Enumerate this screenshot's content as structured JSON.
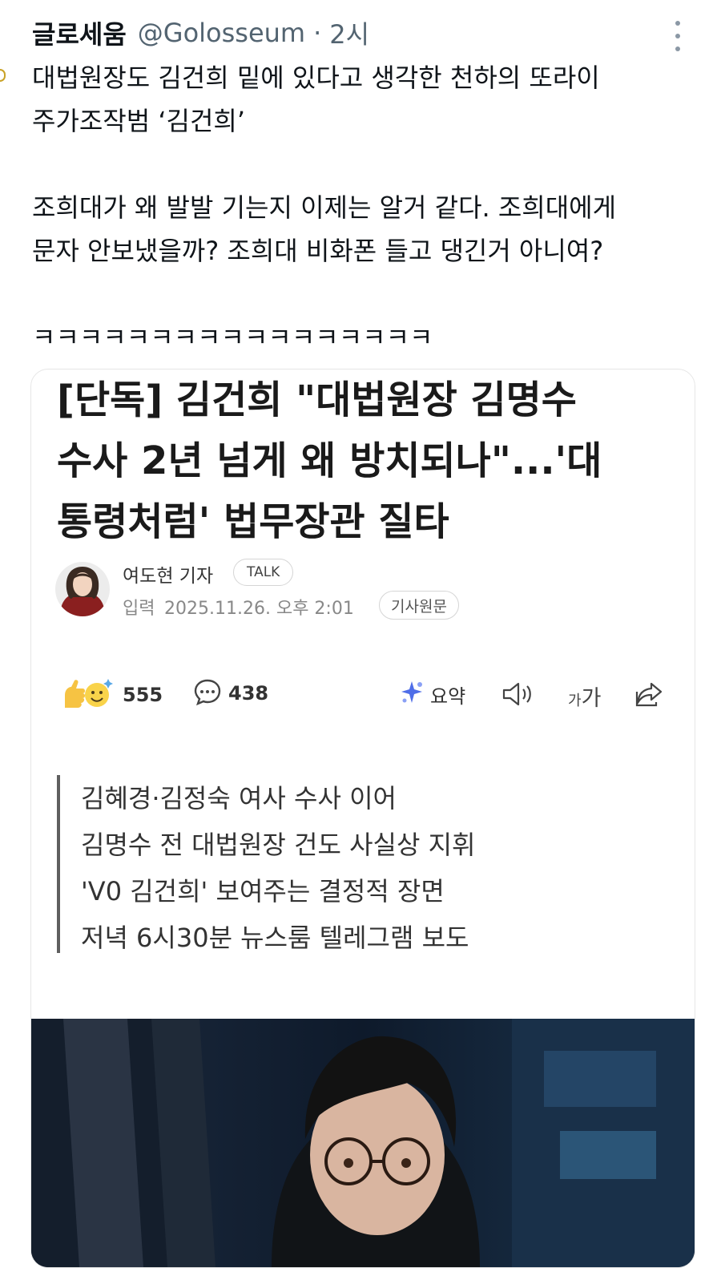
{
  "tweet": {
    "author_name": "글로세움",
    "author_handle": "@Golosseum",
    "separator": "·",
    "time": "2시",
    "lines": [
      "대법원장도 김건희 밑에 있다고 생각한 천하의 또라이",
      "주가조작범 ‘김건희’",
      "",
      "조희대가 왜 발발 기는지 이제는 알거 같다. 조희대에게",
      "문자 안보냈을까? 조희대 비화폰 들고 댕긴거 아니여?",
      "",
      "ㅋㅋㅋㅋㅋㅋㅋㅋㅋㅋㅋㅋㅋㅋㅋㅋㅋ"
    ]
  },
  "article": {
    "headline_lines": [
      "[단독] 김건희 \"대법원장 김명수",
      "수사 2년 넘게 왜 방치되나\"...'대",
      "통령처럼' 법무장관 질타"
    ],
    "reporter": "여도현 기자",
    "talk_label": "TALK",
    "pubdate_label": "입력",
    "pubdate": "2025.11.26. 오후 2:01",
    "original_label": "기사원문",
    "reactions_count": "555",
    "comments_count": "438",
    "summary_label": "요약",
    "font_small": "가",
    "font_big": "가",
    "summary_lines": [
      "김혜경·김정숙 여사 수사 이어",
      "김명수 전 대법원장 건도 사실상 지휘",
      "'V0 김건희' 보여주는 결정적 장면",
      "저녁 6시30분 뉴스룸 텔레그램 보도"
    ]
  },
  "icons": {
    "more": "more-vertical-icon",
    "reaction": "emoji-reaction-icon",
    "comment": "comment-bubble-icon",
    "summary": "ai-summary-sparkle-icon",
    "speaker": "speaker-icon",
    "share": "share-icon"
  },
  "colors": {
    "text": "#0f1419",
    "secondary": "#536471",
    "summary_sparkle": "#4f6ee8",
    "emoji": "#f4c430"
  }
}
